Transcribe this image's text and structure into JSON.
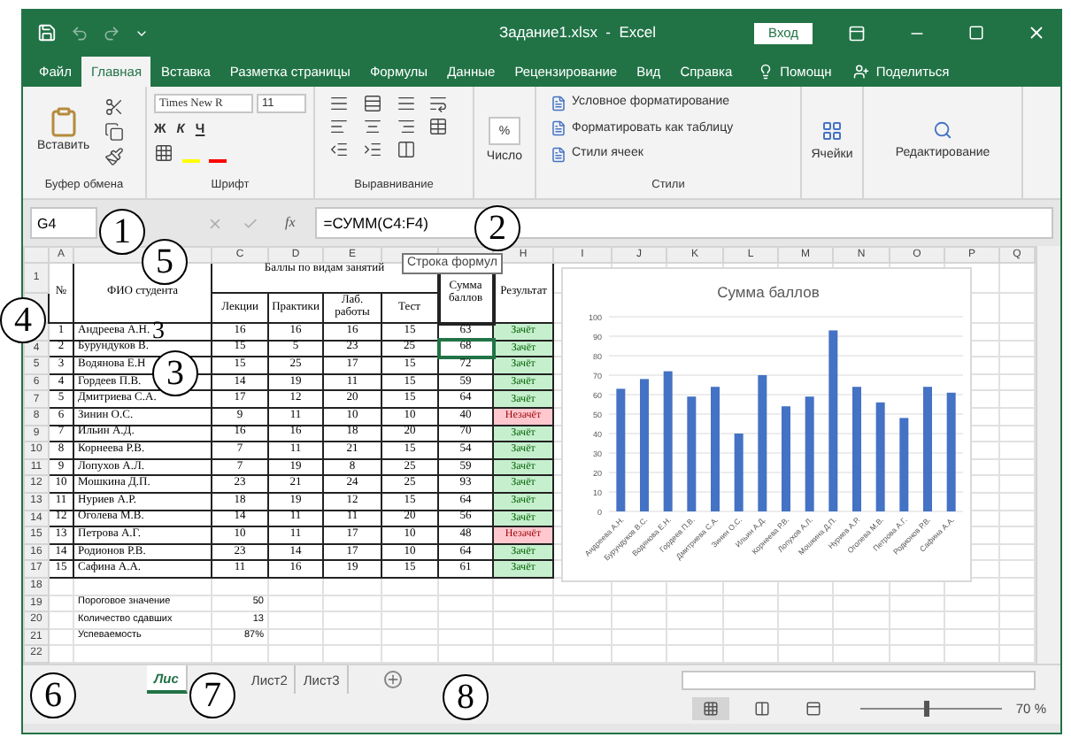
{
  "window": {
    "title": "Задание1.xlsx  -  Excel",
    "sign_in": "Вход"
  },
  "ribbon_tabs": [
    {
      "label": "Файл",
      "selected": false
    },
    {
      "label": "Главная",
      "selected": true
    },
    {
      "label": "Вставка",
      "selected": false
    },
    {
      "label": "Разметка страницы",
      "selected": false
    },
    {
      "label": "Формулы",
      "selected": false
    },
    {
      "label": "Данные",
      "selected": false
    },
    {
      "label": "Рецензирование",
      "selected": false
    },
    {
      "label": "Вид",
      "selected": false
    },
    {
      "label": "Справка",
      "selected": false
    }
  ],
  "tell_me": "Помощн",
  "share": "Поделиться",
  "ribbon": {
    "paste": "Вставить",
    "clipboard_group": "Буфер обмена",
    "font_name": "Times New R",
    "font_size": "11",
    "bold": "Ж",
    "italic": "К",
    "underline": "Ч",
    "font_group": "Шрифт",
    "alignment_group": "Выравнивание",
    "number_symbol": "%",
    "number": "Число",
    "styles": [
      "Условное форматирование",
      "Форматировать как таблицу",
      "Стили ячеек"
    ],
    "styles_group": "Стили",
    "cells": "Ячейки",
    "editing": "Редактирование"
  },
  "formula_bar": {
    "name_box": "G4",
    "fx": "fx",
    "formula": "=СУММ(C4:F4)",
    "tooltip": "Строка формул"
  },
  "column_headers": [
    {
      "label": "A"
    },
    {
      "label": "C"
    },
    {
      "label": "D"
    },
    {
      "label": "E"
    },
    {
      "label": "H"
    },
    {
      "label": "I"
    },
    {
      "label": "J"
    },
    {
      "label": "K"
    },
    {
      "label": "L"
    },
    {
      "label": "M"
    },
    {
      "label": "N"
    },
    {
      "label": "O"
    },
    {
      "label": "P"
    },
    {
      "label": "Q"
    }
  ],
  "row_numbers": [
    {
      "label": "1"
    },
    {
      "label": "4"
    },
    {
      "label": "5"
    },
    {
      "label": "6"
    },
    {
      "label": "7"
    },
    {
      "label": "8"
    },
    {
      "label": "9"
    },
    {
      "label": "10"
    },
    {
      "label": "11"
    },
    {
      "label": "12"
    },
    {
      "label": "13"
    },
    {
      "label": "14"
    },
    {
      "label": "15"
    },
    {
      "label": "16"
    },
    {
      "label": "17"
    },
    {
      "label": "18"
    },
    {
      "label": "19"
    },
    {
      "label": "20"
    },
    {
      "label": "21"
    },
    {
      "label": "22"
    }
  ],
  "table_header": {
    "no": "№",
    "name": "ФИО студента",
    "group": "Баллы по видам занятий",
    "lectures": "Лекции",
    "practice": "Практики",
    "labs": "Лаб. работы",
    "test": "Тест",
    "total": "Сумма баллов",
    "result": "Результат"
  },
  "students": [
    {
      "no": "1",
      "name": "Андреева А.Н.",
      "lectures": "16",
      "practice": "16",
      "labs": "16",
      "test": "15",
      "total": "63",
      "result": "Зачёт",
      "passed": true,
      "selected": false
    },
    {
      "no": "2",
      "name": "Бурундуков В.",
      "lectures": "15",
      "practice": "5",
      "labs": "23",
      "test": "25",
      "total": "68",
      "result": "Зачёт",
      "passed": true,
      "selected": true
    },
    {
      "no": "3",
      "name": "Водянова Е.Н",
      "lectures": "15",
      "practice": "25",
      "labs": "17",
      "test": "15",
      "total": "72",
      "result": "Зачёт",
      "passed": true,
      "selected": false
    },
    {
      "no": "4",
      "name": "Гордеев П.В.",
      "lectures": "14",
      "practice": "19",
      "labs": "11",
      "test": "15",
      "total": "59",
      "result": "Зачёт",
      "passed": true,
      "selected": false
    },
    {
      "no": "5",
      "name": "Дмитриева С.А.",
      "lectures": "17",
      "practice": "12",
      "labs": "20",
      "test": "15",
      "total": "64",
      "result": "Зачёт",
      "passed": true,
      "selected": false
    },
    {
      "no": "6",
      "name": "Зинин О.С.",
      "lectures": "9",
      "practice": "11",
      "labs": "10",
      "test": "10",
      "total": "40",
      "result": "Незачёт",
      "passed": false,
      "selected": false
    },
    {
      "no": "7",
      "name": "Ильин А.Д.",
      "lectures": "16",
      "practice": "16",
      "labs": "18",
      "test": "20",
      "total": "70",
      "result": "Зачёт",
      "passed": true,
      "selected": false
    },
    {
      "no": "8",
      "name": "Корнеева Р.В.",
      "lectures": "7",
      "practice": "11",
      "labs": "21",
      "test": "15",
      "total": "54",
      "result": "Зачёт",
      "passed": true,
      "selected": false
    },
    {
      "no": "9",
      "name": "Лопухов А.Л.",
      "lectures": "7",
      "practice": "19",
      "labs": "8",
      "test": "25",
      "total": "59",
      "result": "Зачёт",
      "passed": true,
      "selected": false
    },
    {
      "no": "10",
      "name": "Мошкина Д.П.",
      "lectures": "23",
      "practice": "21",
      "labs": "24",
      "test": "25",
      "total": "93",
      "result": "Зачёт",
      "passed": true,
      "selected": false
    },
    {
      "no": "11",
      "name": "Нуриев А.Р.",
      "lectures": "18",
      "practice": "19",
      "labs": "12",
      "test": "15",
      "total": "64",
      "result": "Зачёт",
      "passed": true,
      "selected": false
    },
    {
      "no": "12",
      "name": "Оголева М.В.",
      "lectures": "14",
      "practice": "11",
      "labs": "11",
      "test": "20",
      "total": "56",
      "result": "Зачёт",
      "passed": true,
      "selected": false
    },
    {
      "no": "13",
      "name": "Петрова А.Г.",
      "lectures": "10",
      "practice": "11",
      "labs": "17",
      "test": "10",
      "total": "48",
      "result": "Незачёт",
      "passed": false,
      "selected": false
    },
    {
      "no": "14",
      "name": "Родионов Р.В.",
      "lectures": "23",
      "practice": "14",
      "labs": "17",
      "test": "10",
      "total": "64",
      "result": "Зачёт",
      "passed": true,
      "selected": false
    },
    {
      "no": "15",
      "name": "Сафина А.А.",
      "lectures": "11",
      "practice": "16",
      "labs": "19",
      "test": "15",
      "total": "61",
      "result": "Зачёт",
      "passed": true,
      "selected": false
    }
  ],
  "summary": [
    {
      "label": "Пороговое значение",
      "value": "50"
    },
    {
      "label": "Количество сдавших",
      "value": "13"
    },
    {
      "label": "Успеваемость",
      "value": "87%"
    }
  ],
  "chart": {
    "chart_data": {
      "type": "bar",
      "title": "Сумма баллов",
      "categories": [
        "Андреева А.Н.",
        "Бурундуков В.С.",
        "Водянова Е.Н.",
        "Гордеев П.В.",
        "Дмитриева С.А.",
        "Зинин О.С.",
        "Ильин А.Д.",
        "Корнеева Р.В.",
        "Лопухов А.Л.",
        "Мошкина Д.П.",
        "Нуриев А.Р.",
        "Оголева М.В.",
        "Петрова А.Г.",
        "Родионов Р.В.",
        "Сафина А.А."
      ],
      "values": [
        63,
        68,
        72,
        59,
        64,
        40,
        70,
        54,
        59,
        93,
        64,
        56,
        48,
        64,
        61
      ],
      "ylim": [
        0,
        100
      ],
      "grid": true,
      "yticks": [
        0,
        10,
        20,
        30,
        40,
        50,
        60,
        70,
        80,
        90,
        100
      ]
    }
  },
  "sheet_tabs": [
    {
      "label": "Лис",
      "selected": true
    },
    {
      "label": "Лист2",
      "selected": false
    },
    {
      "label": "Лист3",
      "selected": false
    }
  ],
  "status_bar": {
    "views": [
      {
        "kind": "normal",
        "selected": true
      },
      {
        "kind": "layout",
        "selected": false
      },
      {
        "kind": "pagebreak",
        "selected": false
      }
    ],
    "zoom": {
      "level": 0.47,
      "reading": "70 %"
    }
  },
  "callouts": [
    {
      "label": "1",
      "kind": "circle"
    },
    {
      "label": "2",
      "kind": "circle"
    },
    {
      "label": "3",
      "kind": "plain"
    },
    {
      "label": "3",
      "kind": "circle"
    },
    {
      "label": "4",
      "kind": "circle"
    },
    {
      "label": "5",
      "kind": "circle"
    },
    {
      "label": "6",
      "kind": "circle"
    },
    {
      "label": "7",
      "kind": "circle"
    },
    {
      "label": "8",
      "kind": "circle"
    }
  ]
}
